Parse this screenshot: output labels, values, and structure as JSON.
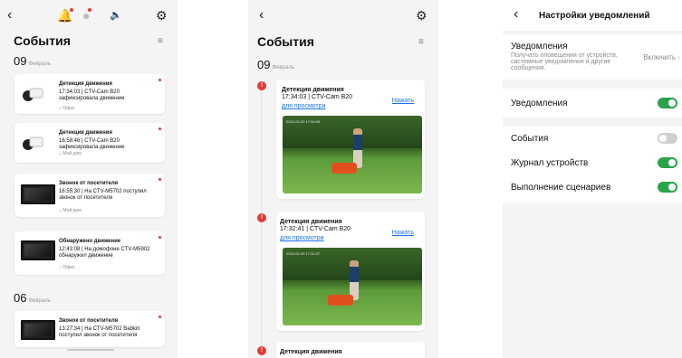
{
  "screen1": {
    "title": "События",
    "dates": [
      {
        "day": "09",
        "month": "Февраль"
      },
      {
        "day": "06",
        "month": "Февраль"
      }
    ],
    "cards": [
      {
        "title": "Детекция движения",
        "desc": "17:34:03 | CTV-Cam B20 зафиксировала движение",
        "loc": "Офис"
      },
      {
        "title": "Детекция движения",
        "desc": "16:58:46 | CTV-Cam B20 зафиксировала движение",
        "loc": "Мой дом"
      },
      {
        "title": "Звонок от посетителя",
        "desc": "16:55:30 | На CTV-M5702 поступил звонок от посетителя",
        "loc": "Мой дом"
      },
      {
        "title": "Обнаружено движение",
        "desc": "12:43:08 | На домофоне CTV-M5902 обнаружил движение",
        "loc": "Офис"
      },
      {
        "title": "Звонок от посетителя",
        "desc": "13:27:34 | На CTV-M5702 Babkin поступил звонок от посетителя",
        "loc": ""
      }
    ]
  },
  "screen2": {
    "title": "События",
    "date": {
      "day": "09",
      "month": "Февраль"
    },
    "cards": [
      {
        "title": "Детекция движения",
        "desc": "17:34:03 | CTV-Cam B20",
        "link1": "Нажать",
        "link2": "для просмотра",
        "timestamp": "2024-02-09 17:34:08"
      },
      {
        "title": "Детекция движения",
        "desc": "17:32:41 | CTV-Cam B20",
        "link1": "Нажать",
        "link2": "для просмотра",
        "timestamp": "2024-02-09 17:32:47"
      },
      {
        "title": "Детекция движения"
      }
    ],
    "badge": "!"
  },
  "screen3": {
    "title": "Настройки уведомлений",
    "notifications_label": "Уведомления",
    "notifications_sub": "Получать оповещения от устройств, системные уведомления и другие сообщения.",
    "enable_label": "Включить",
    "toggle_notifications": "Уведомления",
    "events_label": "События",
    "device_log_label": "Журнал устройств",
    "scenarios_label": "Выполнение сценариев",
    "accent": "#2aa44a"
  }
}
